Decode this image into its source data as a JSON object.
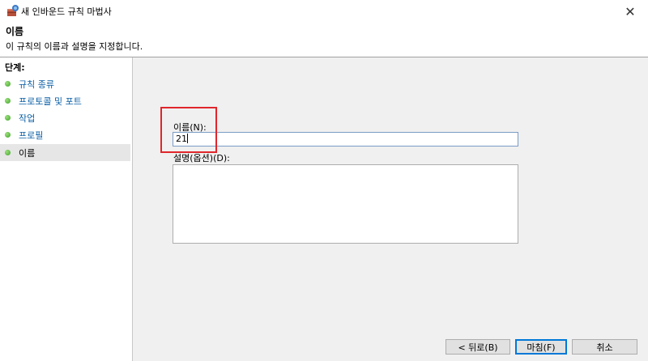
{
  "window": {
    "title": "새 인바운드 규칙 마법사",
    "close_glyph": "✕"
  },
  "header": {
    "title": "이름",
    "description": "이 규칙의 이름과 설명을 지정합니다."
  },
  "sidebar": {
    "steps_label": "단계:",
    "items": [
      {
        "label": "규칙 종류"
      },
      {
        "label": "프로토콜 및 포트"
      },
      {
        "label": "작업"
      },
      {
        "label": "프로필"
      },
      {
        "label": "이름"
      }
    ]
  },
  "form": {
    "name_label": "이름(N):",
    "name_value": "21",
    "description_label": "설명(옵션)(D):"
  },
  "buttons": {
    "back": "< 뒤로(B)",
    "finish": "마침(F)",
    "cancel": "취소"
  },
  "colors": {
    "highlight": "#e0262b",
    "link": "#0b5fa5"
  }
}
